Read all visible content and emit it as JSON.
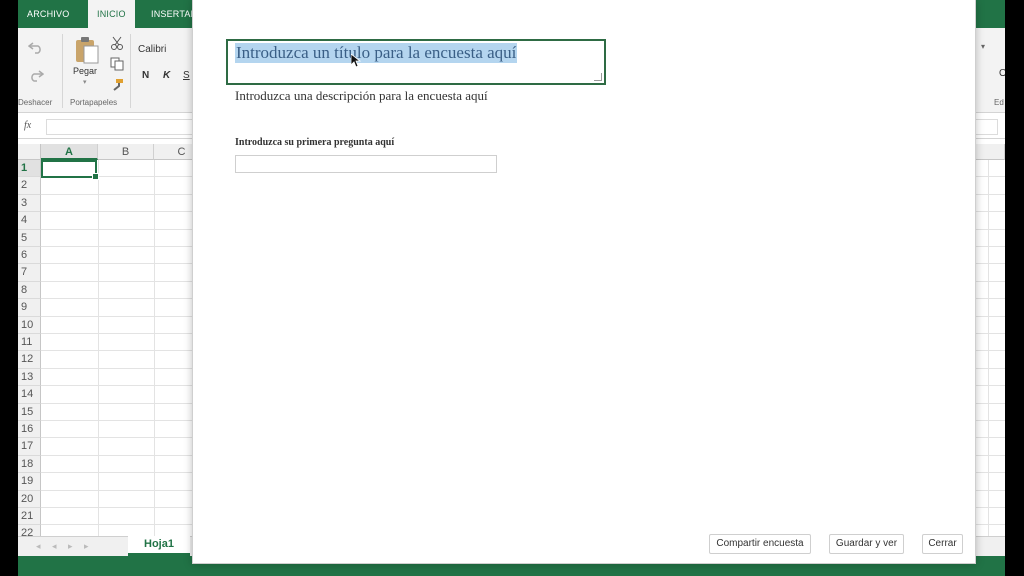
{
  "ribbon": {
    "tabs": [
      "ARCHIVO",
      "INICIO",
      "INSERTAR"
    ],
    "active_tab": "INICIO",
    "undo_group_label": "Deshacer",
    "clipboard_group_label": "Portapapeles",
    "paste_label": "Pegar",
    "font_name": "Calibri",
    "bold_label": "N",
    "italic_label": "K",
    "underline_label": "S",
    "edit_group_label_partial": "Ed",
    "right_peek_letter": "O"
  },
  "formula_bar": {
    "fx_label": "fx"
  },
  "sheet": {
    "columns": [
      "A",
      "B",
      "C"
    ],
    "rows": [
      "1",
      "2",
      "3",
      "4",
      "5",
      "6",
      "7",
      "8",
      "9",
      "10",
      "11",
      "12",
      "13",
      "14",
      "15",
      "16",
      "17",
      "18",
      "19",
      "20",
      "21",
      "22"
    ],
    "selected_cell": "A1",
    "tab_name": "Hoja1"
  },
  "survey": {
    "title": "Introduzca un título para la encuesta aquí",
    "description": "Introduzca una descripción para la encuesta aquí",
    "question_label": "Introduzca su primera pregunta aquí",
    "question_value": "",
    "buttons": {
      "share": "Compartir encuesta",
      "save_view": "Guardar y ver",
      "close": "Cerrar"
    }
  },
  "colors": {
    "excel_green": "#217346",
    "selection_blue": "#b4d5ef"
  }
}
